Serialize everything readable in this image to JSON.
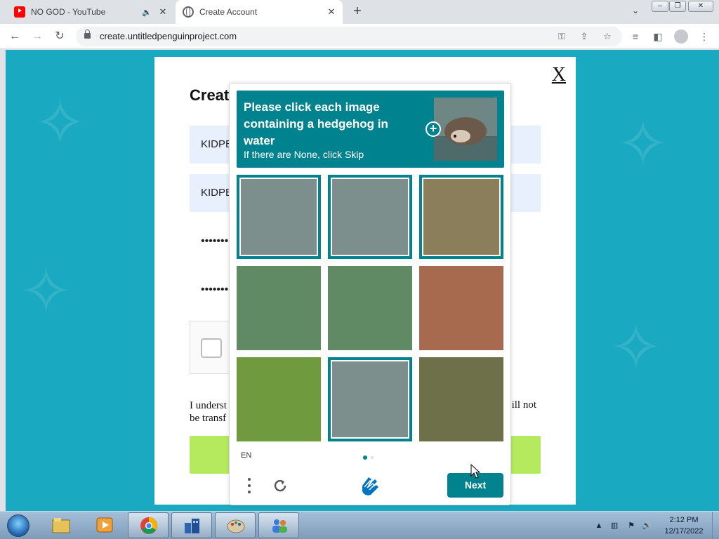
{
  "browser": {
    "tabs": [
      {
        "title": "NO GOD - YouTube",
        "icon": "youtube-icon",
        "audio_icon": "speaker-icon"
      },
      {
        "title": "Create Account",
        "icon": "globe-icon"
      }
    ],
    "address_bar": {
      "url": "create.untitledpenguinproject.com"
    }
  },
  "page": {
    "close_label": "X",
    "title": "Creat",
    "fields": [
      "KIDPE",
      "KIDPE"
    ],
    "passwords": [
      "••••••••",
      "••••••••"
    ],
    "terms_left": "I underst",
    "terms_left_line2": "be transf",
    "terms_right": "ill not",
    "background_color": "#19a9c1",
    "submit_color": "#b5ea5f"
  },
  "captcha": {
    "prompt": "Please click each image containing a hedgehog in water",
    "subprompt": "If there are None, click Skip",
    "example_image": "hedgehog-in-water-example-image",
    "tiles": [
      {
        "subject": "hedgehog-in-water-image",
        "selected": true
      },
      {
        "subject": "hedgehog-in-water-image",
        "selected": true
      },
      {
        "subject": "hedgehog-on-grass-image",
        "selected": true
      },
      {
        "subject": "turtle-underwater-image",
        "selected": false
      },
      {
        "subject": "turtle-underwater-image",
        "selected": false
      },
      {
        "subject": "hedgehog-on-sand-image",
        "selected": false
      },
      {
        "subject": "rabbit-on-grass-image",
        "selected": false
      },
      {
        "subject": "hedgehog-in-water-image",
        "selected": true
      },
      {
        "subject": "squirrel-on-tree-image",
        "selected": false
      }
    ],
    "language": "EN",
    "next_label": "Next",
    "accent_color": "#00838f"
  },
  "taskbar": {
    "apps": [
      "chrome-icon",
      "file-explorer-icon",
      "media-player-icon",
      "chrome-icon",
      "buildings-icon",
      "paint-icon",
      "people-icon"
    ],
    "clock_time": "2:12 PM",
    "clock_date": "12/17/2022"
  }
}
